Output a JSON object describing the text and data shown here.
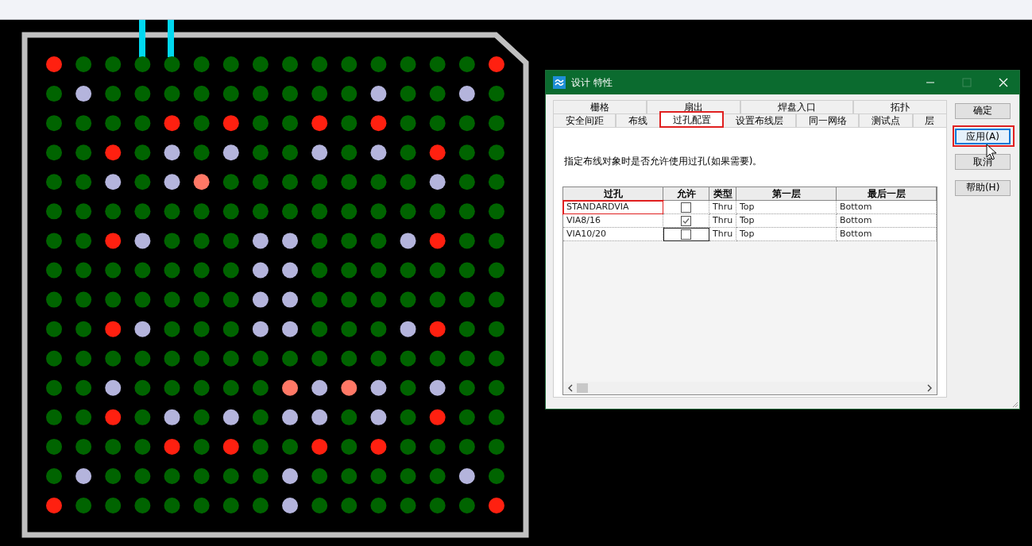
{
  "pad_rows": [
    {
      "pads": [
        {
          "color": "#ff2010"
        },
        {
          "color": "#006400"
        },
        {
          "color": "#006400"
        },
        {
          "color": "#006400"
        },
        {
          "color": "#006400"
        },
        {
          "color": "#006400"
        },
        {
          "color": "#006400"
        },
        {
          "color": "#006400"
        },
        {
          "color": "#006400"
        },
        {
          "color": "#006400"
        },
        {
          "color": "#006400"
        },
        {
          "color": "#006400"
        },
        {
          "color": "#006400"
        },
        {
          "color": "#006400"
        },
        {
          "color": "#006400"
        },
        {
          "color": "#ff2010"
        }
      ]
    },
    {
      "pads": [
        {
          "color": "#006400"
        },
        {
          "color": "#b4b4dc"
        },
        {
          "color": "#006400"
        },
        {
          "color": "#006400"
        },
        {
          "color": "#006400"
        },
        {
          "color": "#006400"
        },
        {
          "color": "#006400"
        },
        {
          "color": "#006400"
        },
        {
          "color": "#006400"
        },
        {
          "color": "#006400"
        },
        {
          "color": "#006400"
        },
        {
          "color": "#b4b4dc"
        },
        {
          "color": "#006400"
        },
        {
          "color": "#006400"
        },
        {
          "color": "#b4b4dc"
        },
        {
          "color": "#006400"
        }
      ]
    },
    {
      "pads": [
        {
          "color": "#006400"
        },
        {
          "color": "#006400"
        },
        {
          "color": "#006400"
        },
        {
          "color": "#006400"
        },
        {
          "color": "#ff2010"
        },
        {
          "color": "#006400"
        },
        {
          "color": "#ff2010"
        },
        {
          "color": "#006400"
        },
        {
          "color": "#006400"
        },
        {
          "color": "#ff2010"
        },
        {
          "color": "#006400"
        },
        {
          "color": "#ff2010"
        },
        {
          "color": "#006400"
        },
        {
          "color": "#006400"
        },
        {
          "color": "#006400"
        },
        {
          "color": "#006400"
        }
      ]
    },
    {
      "pads": [
        {
          "color": "#006400"
        },
        {
          "color": "#006400"
        },
        {
          "color": "#ff2010"
        },
        {
          "color": "#006400"
        },
        {
          "color": "#b4b4dc"
        },
        {
          "color": "#006400"
        },
        {
          "color": "#b4b4dc"
        },
        {
          "color": "#006400"
        },
        {
          "color": "#006400"
        },
        {
          "color": "#b4b4dc"
        },
        {
          "color": "#006400"
        },
        {
          "color": "#b4b4dc"
        },
        {
          "color": "#006400"
        },
        {
          "color": "#ff2010"
        },
        {
          "color": "#006400"
        },
        {
          "color": "#006400"
        }
      ]
    },
    {
      "pads": [
        {
          "color": "#006400"
        },
        {
          "color": "#006400"
        },
        {
          "color": "#b4b4dc"
        },
        {
          "color": "#006400"
        },
        {
          "color": "#b4b4dc"
        },
        {
          "color": "#ff7866"
        },
        {
          "color": "#006400"
        },
        {
          "color": "#006400"
        },
        {
          "color": "#006400"
        },
        {
          "color": "#006400"
        },
        {
          "color": "#006400"
        },
        {
          "color": "#006400"
        },
        {
          "color": "#006400"
        },
        {
          "color": "#b4b4dc"
        },
        {
          "color": "#006400"
        },
        {
          "color": "#006400"
        }
      ]
    },
    {
      "pads": [
        {
          "color": "#006400"
        },
        {
          "color": "#006400"
        },
        {
          "color": "#006400"
        },
        {
          "color": "#006400"
        },
        {
          "color": "#006400"
        },
        {
          "color": "#006400"
        },
        {
          "color": "#006400"
        },
        {
          "color": "#006400"
        },
        {
          "color": "#006400"
        },
        {
          "color": "#006400"
        },
        {
          "color": "#006400"
        },
        {
          "color": "#006400"
        },
        {
          "color": "#006400"
        },
        {
          "color": "#006400"
        },
        {
          "color": "#006400"
        },
        {
          "color": "#006400"
        }
      ]
    },
    {
      "pads": [
        {
          "color": "#006400"
        },
        {
          "color": "#006400"
        },
        {
          "color": "#ff2010"
        },
        {
          "color": "#b4b4dc"
        },
        {
          "color": "#006400"
        },
        {
          "color": "#006400"
        },
        {
          "color": "#006400"
        },
        {
          "color": "#b4b4dc"
        },
        {
          "color": "#b4b4dc"
        },
        {
          "color": "#006400"
        },
        {
          "color": "#006400"
        },
        {
          "color": "#006400"
        },
        {
          "color": "#b4b4dc"
        },
        {
          "color": "#ff2010"
        },
        {
          "color": "#006400"
        },
        {
          "color": "#006400"
        }
      ]
    },
    {
      "pads": [
        {
          "color": "#006400"
        },
        {
          "color": "#006400"
        },
        {
          "color": "#006400"
        },
        {
          "color": "#006400"
        },
        {
          "color": "#006400"
        },
        {
          "color": "#006400"
        },
        {
          "color": "#006400"
        },
        {
          "color": "#b4b4dc"
        },
        {
          "color": "#b4b4dc"
        },
        {
          "color": "#006400"
        },
        {
          "color": "#006400"
        },
        {
          "color": "#006400"
        },
        {
          "color": "#006400"
        },
        {
          "color": "#006400"
        },
        {
          "color": "#006400"
        },
        {
          "color": "#006400"
        }
      ]
    },
    {
      "pads": [
        {
          "color": "#006400"
        },
        {
          "color": "#006400"
        },
        {
          "color": "#006400"
        },
        {
          "color": "#006400"
        },
        {
          "color": "#006400"
        },
        {
          "color": "#006400"
        },
        {
          "color": "#006400"
        },
        {
          "color": "#b4b4dc"
        },
        {
          "color": "#b4b4dc"
        },
        {
          "color": "#006400"
        },
        {
          "color": "#006400"
        },
        {
          "color": "#006400"
        },
        {
          "color": "#006400"
        },
        {
          "color": "#006400"
        },
        {
          "color": "#006400"
        },
        {
          "color": "#006400"
        }
      ]
    },
    {
      "pads": [
        {
          "color": "#006400"
        },
        {
          "color": "#006400"
        },
        {
          "color": "#ff2010"
        },
        {
          "color": "#b4b4dc"
        },
        {
          "color": "#006400"
        },
        {
          "color": "#006400"
        },
        {
          "color": "#006400"
        },
        {
          "color": "#b4b4dc"
        },
        {
          "color": "#b4b4dc"
        },
        {
          "color": "#006400"
        },
        {
          "color": "#006400"
        },
        {
          "color": "#006400"
        },
        {
          "color": "#b4b4dc"
        },
        {
          "color": "#ff2010"
        },
        {
          "color": "#006400"
        },
        {
          "color": "#006400"
        }
      ]
    },
    {
      "pads": [
        {
          "color": "#006400"
        },
        {
          "color": "#006400"
        },
        {
          "color": "#006400"
        },
        {
          "color": "#006400"
        },
        {
          "color": "#006400"
        },
        {
          "color": "#006400"
        },
        {
          "color": "#006400"
        },
        {
          "color": "#006400"
        },
        {
          "color": "#006400"
        },
        {
          "color": "#006400"
        },
        {
          "color": "#006400"
        },
        {
          "color": "#006400"
        },
        {
          "color": "#006400"
        },
        {
          "color": "#006400"
        },
        {
          "color": "#006400"
        },
        {
          "color": "#006400"
        }
      ]
    },
    {
      "pads": [
        {
          "color": "#006400"
        },
        {
          "color": "#006400"
        },
        {
          "color": "#b4b4dc"
        },
        {
          "color": "#006400"
        },
        {
          "color": "#006400"
        },
        {
          "color": "#006400"
        },
        {
          "color": "#006400"
        },
        {
          "color": "#006400"
        },
        {
          "color": "#ff7866"
        },
        {
          "color": "#b4b4dc"
        },
        {
          "color": "#ff7866"
        },
        {
          "color": "#b4b4dc"
        },
        {
          "color": "#006400"
        },
        {
          "color": "#b4b4dc"
        },
        {
          "color": "#006400"
        },
        {
          "color": "#006400"
        }
      ]
    },
    {
      "pads": [
        {
          "color": "#006400"
        },
        {
          "color": "#006400"
        },
        {
          "color": "#ff2010"
        },
        {
          "color": "#006400"
        },
        {
          "color": "#b4b4dc"
        },
        {
          "color": "#006400"
        },
        {
          "color": "#b4b4dc"
        },
        {
          "color": "#006400"
        },
        {
          "color": "#b4b4dc"
        },
        {
          "color": "#b4b4dc"
        },
        {
          "color": "#006400"
        },
        {
          "color": "#b4b4dc"
        },
        {
          "color": "#006400"
        },
        {
          "color": "#ff2010"
        },
        {
          "color": "#006400"
        },
        {
          "color": "#006400"
        }
      ]
    },
    {
      "pads": [
        {
          "color": "#006400"
        },
        {
          "color": "#006400"
        },
        {
          "color": "#006400"
        },
        {
          "color": "#006400"
        },
        {
          "color": "#ff2010"
        },
        {
          "color": "#006400"
        },
        {
          "color": "#ff2010"
        },
        {
          "color": "#006400"
        },
        {
          "color": "#006400"
        },
        {
          "color": "#ff2010"
        },
        {
          "color": "#006400"
        },
        {
          "color": "#ff2010"
        },
        {
          "color": "#006400"
        },
        {
          "color": "#006400"
        },
        {
          "color": "#006400"
        },
        {
          "color": "#006400"
        }
      ]
    },
    {
      "pads": [
        {
          "color": "#006400"
        },
        {
          "color": "#b4b4dc"
        },
        {
          "color": "#006400"
        },
        {
          "color": "#006400"
        },
        {
          "color": "#006400"
        },
        {
          "color": "#006400"
        },
        {
          "color": "#006400"
        },
        {
          "color": "#006400"
        },
        {
          "color": "#b4b4dc"
        },
        {
          "color": "#006400"
        },
        {
          "color": "#006400"
        },
        {
          "color": "#006400"
        },
        {
          "color": "#006400"
        },
        {
          "color": "#006400"
        },
        {
          "color": "#b4b4dc"
        },
        {
          "color": "#006400"
        }
      ]
    },
    {
      "pads": [
        {
          "color": "#ff2010"
        },
        {
          "color": "#006400"
        },
        {
          "color": "#006400"
        },
        {
          "color": "#006400"
        },
        {
          "color": "#006400"
        },
        {
          "color": "#006400"
        },
        {
          "color": "#006400"
        },
        {
          "color": "#006400"
        },
        {
          "color": "#b4b4dc"
        },
        {
          "color": "#006400"
        },
        {
          "color": "#006400"
        },
        {
          "color": "#006400"
        },
        {
          "color": "#006400"
        },
        {
          "color": "#006400"
        },
        {
          "color": "#006400"
        },
        {
          "color": "#ff2010"
        }
      ]
    }
  ],
  "dialog": {
    "title": "设计 特性",
    "window_controls": [
      {
        "kind": "minimize",
        "disabled": false
      },
      {
        "kind": "maximize",
        "disabled": true
      },
      {
        "kind": "close",
        "disabled": false
      }
    ],
    "tab_rows": [
      [
        {
          "label": "栅格",
          "selected": false,
          "highlighted": false
        },
        {
          "label": "扇出",
          "selected": false,
          "highlighted": false
        },
        {
          "label": "焊盘入口",
          "selected": false,
          "highlighted": false
        },
        {
          "label": "拓扑",
          "selected": false,
          "highlighted": false
        }
      ],
      [
        {
          "label": "安全间距",
          "selected": false,
          "highlighted": false
        },
        {
          "label": "布线",
          "selected": false,
          "highlighted": false
        },
        {
          "label": "过孔配置",
          "selected": true,
          "highlighted": true
        },
        {
          "label": "设置布线层",
          "selected": false,
          "highlighted": false
        },
        {
          "label": "同一网络",
          "selected": false,
          "highlighted": false
        },
        {
          "label": "测试点",
          "selected": false,
          "highlighted": false
        },
        {
          "label": "层",
          "selected": false,
          "highlighted": false
        }
      ]
    ],
    "description": "指定布线对象时是否允许使用过孔(如果需要)。",
    "via_table": {
      "columns": [
        "过孔",
        "允许",
        "类型",
        "第一层",
        "最后一层"
      ],
      "rows": [
        {
          "name": "STANDARDVIA",
          "allowed": false,
          "type": "Thru",
          "first_layer": "Top",
          "last_layer": "Bottom",
          "highlighted": true,
          "focused": false
        },
        {
          "name": "VIA8/16",
          "allowed": true,
          "type": "Thru",
          "first_layer": "Top",
          "last_layer": "Bottom",
          "highlighted": false,
          "focused": false
        },
        {
          "name": "VIA10/20",
          "allowed": false,
          "type": "Thru",
          "first_layer": "Top",
          "last_layer": "Bottom",
          "highlighted": false,
          "focused": true
        }
      ]
    },
    "buttons": [
      {
        "label": "确定",
        "focused": false,
        "highlighted": false
      },
      {
        "label": "应用(A)",
        "focused": true,
        "highlighted": true
      },
      {
        "label": "取消",
        "focused": false,
        "highlighted": false
      },
      {
        "label": "帮助(H)",
        "focused": false,
        "highlighted": false
      }
    ]
  }
}
